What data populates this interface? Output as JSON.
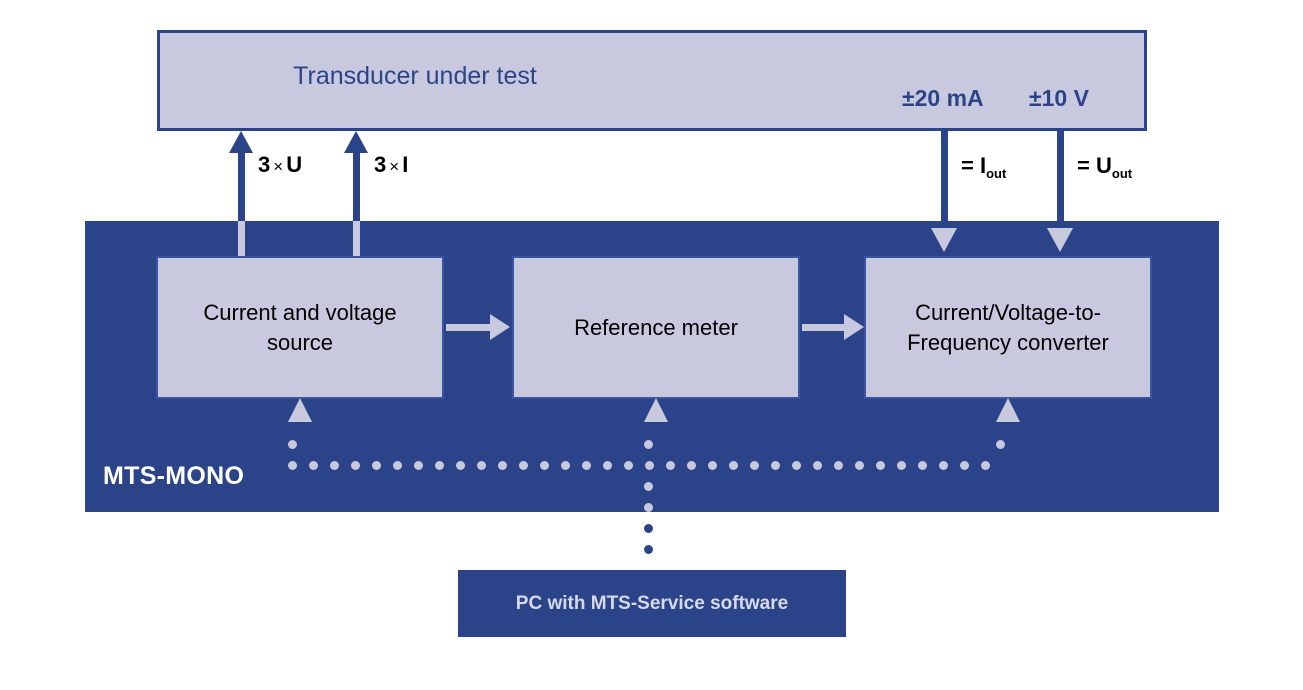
{
  "diagram": {
    "title": "MTS-MONO calibration system block diagram",
    "colors": {
      "panel_blue": "#2b4489",
      "box_lavender": "#c8c9df",
      "text_black": "#000000",
      "text_white": "#ffffff",
      "pc_text": "#d7d9ea"
    }
  },
  "transducer": {
    "title": "Transducer under test",
    "range_current": "±20 mA",
    "range_voltage": "±10 V"
  },
  "panel": {
    "label": "MTS-MONO"
  },
  "modules": [
    {
      "id": "source",
      "label": "Current and voltage source"
    },
    {
      "id": "reference",
      "label": "Reference meter"
    },
    {
      "id": "converter",
      "label": "Current/Voltage-to-Frequency converter"
    }
  ],
  "pc": {
    "label": "PC with MTS-Service software"
  },
  "flow_labels": {
    "three_u_num": "3",
    "three_u_times": "×",
    "three_u_unit": "U",
    "three_i_num": "3",
    "three_i_times": "×",
    "three_i_unit": "I",
    "i_out_eq": "=",
    "i_out_sym": "I",
    "i_out_sub": "out",
    "u_out_eq": "=",
    "u_out_sym": "U",
    "u_out_sub": "out"
  }
}
